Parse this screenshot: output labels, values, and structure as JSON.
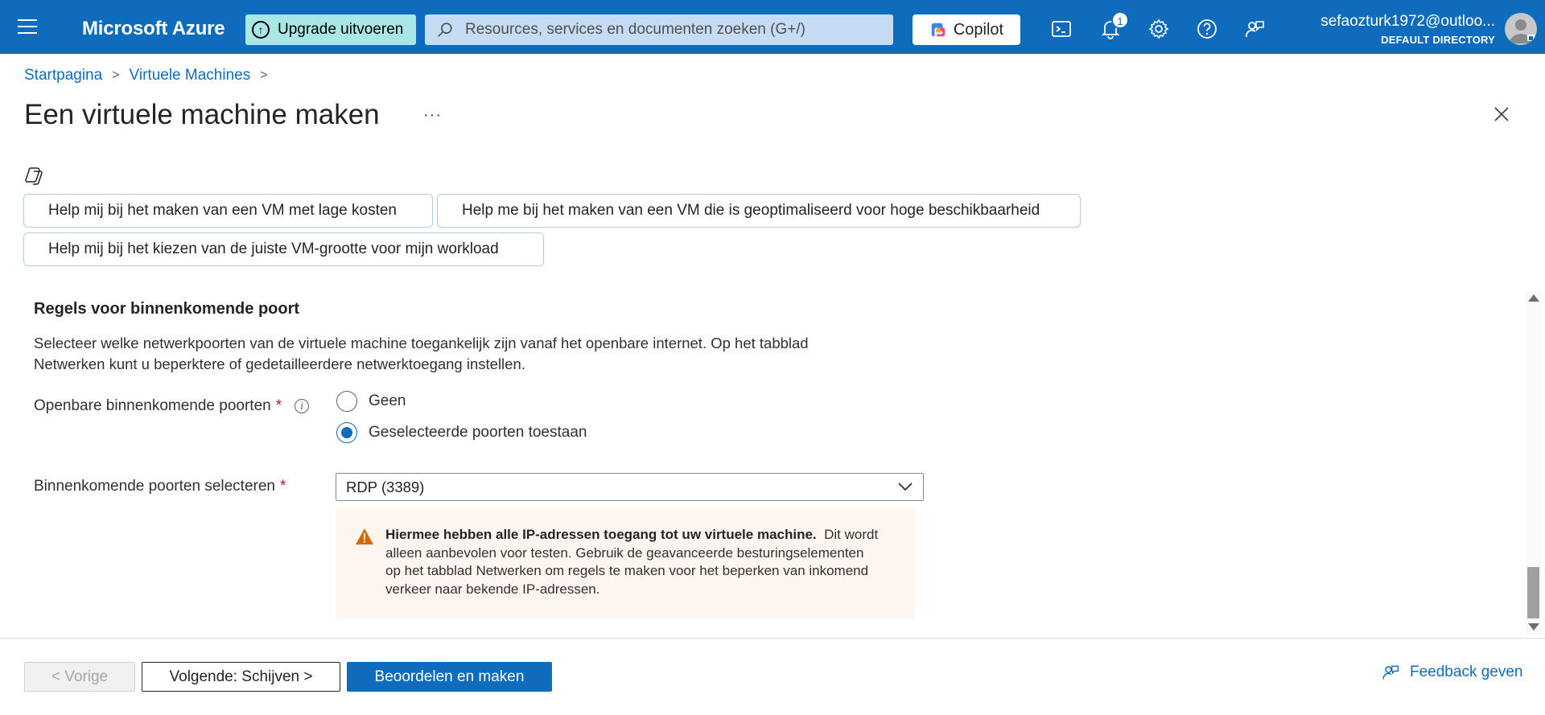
{
  "header": {
    "brand": "Microsoft Azure",
    "upgrade_label": "Upgrade uitvoeren",
    "search_placeholder": "Resources, services en documenten zoeken (G+/)",
    "copilot_label": "Copilot",
    "notifications_count": "1",
    "account_email": "sefaozturk1972@outloo...",
    "account_directory": "DEFAULT DIRECTORY"
  },
  "breadcrumb": {
    "items": [
      "Startpagina",
      "Virtuele Machines"
    ]
  },
  "page": {
    "title": "Een virtuele machine maken",
    "more": "···"
  },
  "copilot_suggestions": [
    "Help mij bij het maken van een VM met lage kosten",
    "Help me bij het maken van een VM die is geoptimaliseerd voor hoge beschikbaarheid",
    "Help mij bij het kiezen van de juiste VM-grootte voor mijn workload"
  ],
  "inbound_rules": {
    "section_title": "Regels voor binnenkomende poort",
    "description": "Selecteer welke netwerkpoorten van de virtuele machine toegankelijk zijn vanaf het openbare internet. Op het tabblad Netwerken kunt u beperktere of gedetailleerdere netwerktoegang instellen.",
    "public_ports_label": "Openbare binnenkomende poorten",
    "required_mark": "*",
    "info_glyph": "i",
    "radio_options": [
      "Geen",
      "Geselecteerde poorten toestaan"
    ],
    "selected_option": "Geselecteerde poorten toestaan",
    "select_ports_label": "Binnenkomende poorten selecteren",
    "select_ports_value": "RDP (3389)",
    "warning_bold": "Hiermee hebben alle IP-adressen toegang tot uw virtuele machine.",
    "warning_text": "Dit wordt alleen aanbevolen voor testen.  Gebruik de geavanceerde besturingselementen op het tabblad Netwerken om regels te maken voor het beperken van inkomend verkeer naar bekende IP-adressen."
  },
  "footer": {
    "prev_label": "< Vorige",
    "next_label": "Volgende: Schijven >",
    "review_label": "Beoordelen en maken",
    "feedback_label": "Feedback geven"
  },
  "colors": {
    "header_bg": "#0f6cbd",
    "upgrade_bg": "#a9e6e6",
    "accent": "#0f6cbd",
    "warning_bg": "#fdf6f0",
    "warning_icon": "#d66a00"
  },
  "icons": [
    "menu-icon",
    "upgrade-icon",
    "search-icon",
    "copilot-logo-icon",
    "cloud-shell-icon",
    "bell-icon",
    "gear-icon",
    "help-icon",
    "feedback-icon",
    "avatar-icon",
    "close-icon",
    "copilot-icon",
    "info-icon",
    "chevron-down-icon",
    "warning-icon"
  ]
}
